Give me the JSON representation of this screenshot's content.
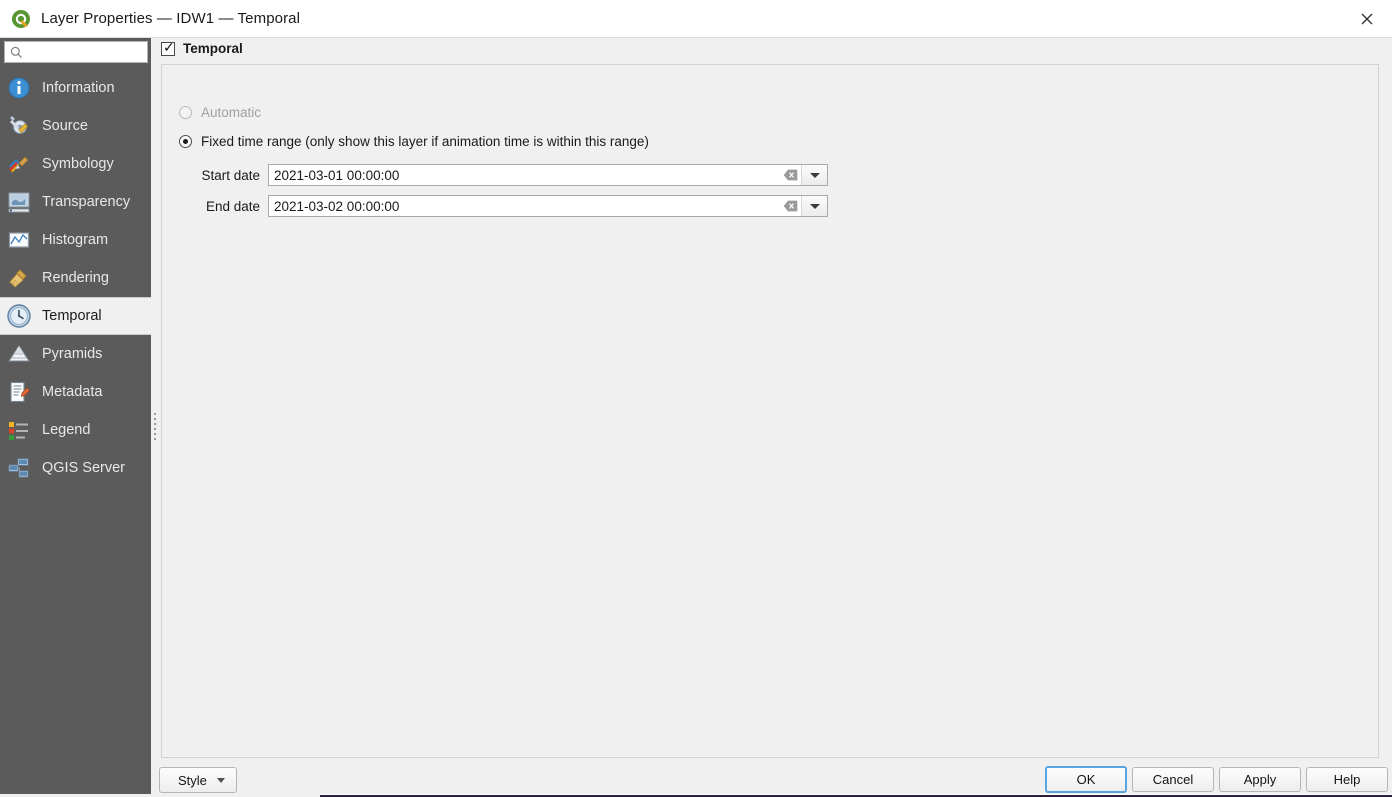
{
  "window": {
    "title": "Layer Properties — IDW1 — Temporal",
    "app_icon": "qgis-logo-icon",
    "close_label": "✕"
  },
  "sidebar": {
    "search": {
      "value": "",
      "placeholder": "",
      "icon": "search-icon"
    },
    "items": [
      {
        "label": "Information",
        "icon": "information-icon",
        "selected": false
      },
      {
        "label": "Source",
        "icon": "source-wrench-icon",
        "selected": false
      },
      {
        "label": "Symbology",
        "icon": "symbology-brush-icon",
        "selected": false
      },
      {
        "label": "Transparency",
        "icon": "transparency-icon",
        "selected": false
      },
      {
        "label": "Histogram",
        "icon": "histogram-icon",
        "selected": false
      },
      {
        "label": "Rendering",
        "icon": "rendering-broom-icon",
        "selected": false
      },
      {
        "label": "Temporal",
        "icon": "clock-icon",
        "selected": true
      },
      {
        "label": "Pyramids",
        "icon": "pyramids-icon",
        "selected": false
      },
      {
        "label": "Metadata",
        "icon": "metadata-pencil-icon",
        "selected": false
      },
      {
        "label": "Legend",
        "icon": "legend-icon",
        "selected": false
      },
      {
        "label": "QGIS Server",
        "icon": "server-icon",
        "selected": false
      }
    ]
  },
  "main": {
    "temporal_checkbox": {
      "label": "Temporal",
      "checked": true
    },
    "mode_automatic": {
      "label": "Automatic",
      "selected": false,
      "disabled": true
    },
    "mode_fixed": {
      "label": "Fixed time range (only show this layer if animation time is within this range)",
      "selected": true,
      "disabled": false
    },
    "start_date": {
      "label": "Start date",
      "value": "2021-03-01 00:00:00",
      "clear_icon": "clear-icon",
      "dropdown_icon": "chevron-down-icon"
    },
    "end_date": {
      "label": "End date",
      "value": "2021-03-02 00:00:00",
      "clear_icon": "clear-icon",
      "dropdown_icon": "chevron-down-icon"
    }
  },
  "footer": {
    "style_button": {
      "label": "Style",
      "icon": "chevron-down-icon"
    },
    "ok": "OK",
    "cancel": "Cancel",
    "apply": "Apply",
    "help": "Help"
  },
  "colors": {
    "sidebar_bg": "#5b5b5b",
    "content_bg": "#f0f0f0",
    "selected_item_bg": "#f0f0f0",
    "focus_border": "#5aa5e0",
    "field_bg": "#ffffff"
  }
}
